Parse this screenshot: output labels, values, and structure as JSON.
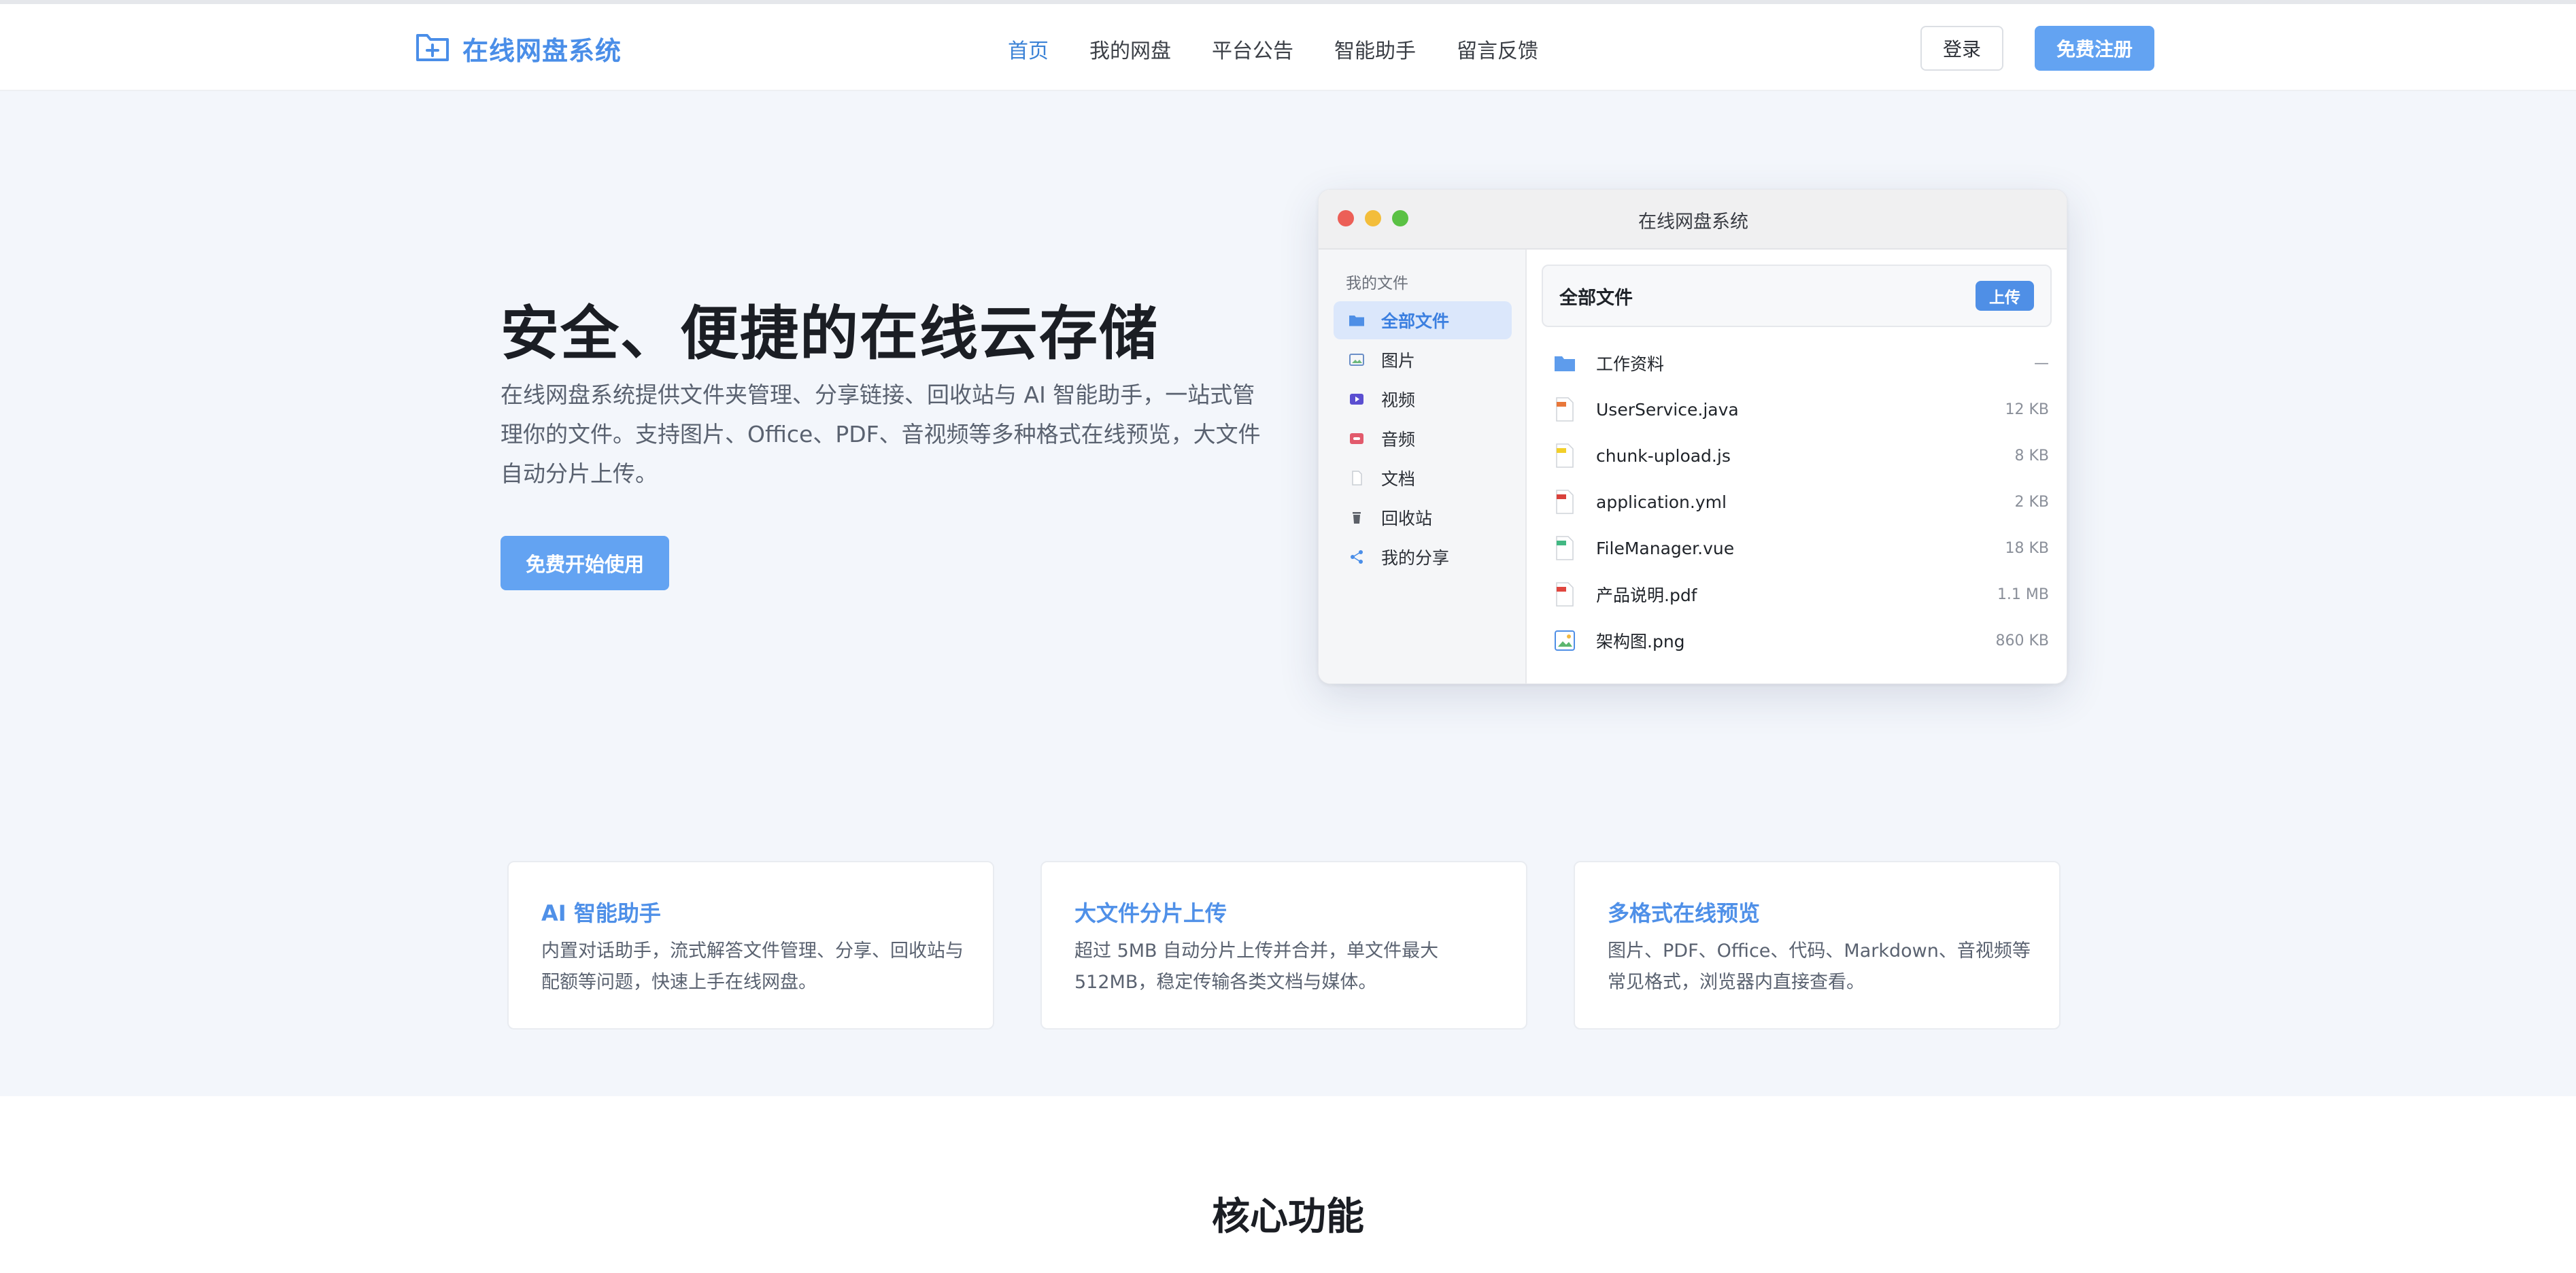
{
  "header": {
    "logo_text": "在线网盘系统",
    "nav": [
      "首页",
      "我的网盘",
      "平台公告",
      "智能助手",
      "留言反馈"
    ],
    "login": "登录",
    "register": "免费注册"
  },
  "hero": {
    "title": "安全、便捷的在线云存储",
    "description": "在线网盘系统提供文件夹管理、分享链接、回收站与 AI 智能助手，一站式管理你的文件。支持图片、Office、PDF、音视频等多种格式在线预览，大文件自动分片上传。",
    "cta": "免费开始使用"
  },
  "mock": {
    "window_title": "在线网盘系统",
    "sidebar_heading": "我的文件",
    "sidebar": [
      "全部文件",
      "图片",
      "视频",
      "音频",
      "文档",
      "回收站",
      "我的分享"
    ],
    "toolbar_title": "全部文件",
    "upload": "上传",
    "files": [
      {
        "name": "工作资料",
        "size": "—"
      },
      {
        "name": "UserService.java",
        "size": "12 KB"
      },
      {
        "name": "chunk-upload.js",
        "size": "8 KB"
      },
      {
        "name": "application.yml",
        "size": "2 KB"
      },
      {
        "name": "FileManager.vue",
        "size": "18 KB"
      },
      {
        "name": "产品说明.pdf",
        "size": "1.1 MB"
      },
      {
        "name": "架构图.png",
        "size": "860 KB"
      }
    ]
  },
  "features": [
    {
      "title": "AI 智能助手",
      "desc": "内置对话助手，流式解答文件管理、分享、回收站与配额等问题，快速上手在线网盘。"
    },
    {
      "title": "大文件分片上传",
      "desc": "超过 5MB 自动分片上传并合并，单文件最大 512MB，稳定传输各类文档与媒体。"
    },
    {
      "title": "多格式在线预览",
      "desc": "图片、PDF、Office、代码、Markdown、音视频等常见格式，浏览器内直接查看。"
    }
  ],
  "section_title": "核心功能",
  "colors": {
    "accent": "#4a8ee8",
    "button": "#63a3f2",
    "background": "#f3f6fb"
  },
  "icons": {
    "logo": "folder-plus-icon",
    "sidebar": [
      "folder-icon",
      "image-icon",
      "video-icon",
      "audio-icon",
      "document-icon",
      "trash-icon",
      "share-icon"
    ],
    "files": [
      "folder-icon",
      "java-file-icon",
      "js-file-icon",
      "yml-file-icon",
      "vue-file-icon",
      "pdf-file-icon",
      "png-file-icon"
    ]
  }
}
